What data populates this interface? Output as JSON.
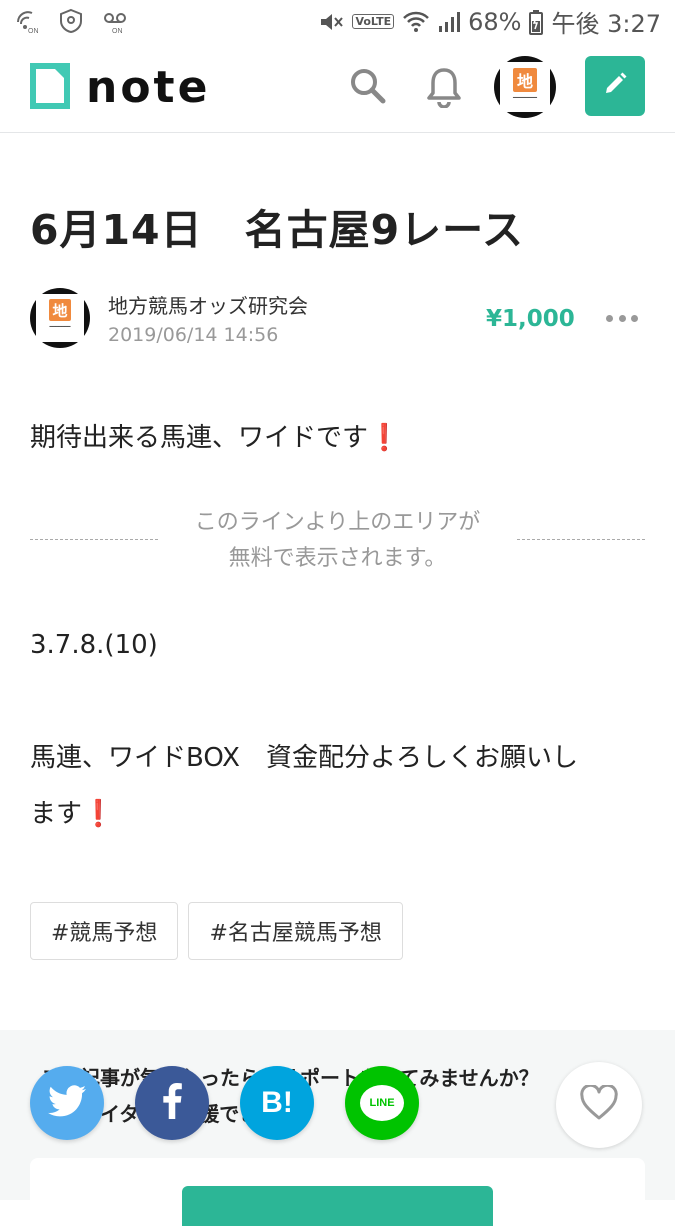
{
  "status_bar": {
    "battery": "68%",
    "time": "午後 3:27",
    "volte": "VoLTE",
    "left_icons": [
      "wifi-calling-icon",
      "shield-icon",
      "voicemail-icon"
    ],
    "right_icons": [
      "mute-icon",
      "wifi-icon",
      "signal-icon",
      "battery-charging-icon"
    ]
  },
  "header": {
    "logo_text": "note",
    "icons": [
      "search-icon",
      "bell-icon",
      "avatar",
      "edit-pencil-icon"
    ],
    "avatar_char": "地",
    "accent_color": "#2cb696"
  },
  "article": {
    "title": "6月14日　名古屋9レース",
    "author": {
      "name": "地方競馬オッズ研究会",
      "date": "2019/06/14 14:56",
      "avatar_char": "地"
    },
    "price": "¥1,000",
    "intro_text": "期待出来る馬連、ワイドです",
    "exclaim": "❗",
    "paywall_line1": "このラインより上のエリアが",
    "paywall_line2": "無料で表示されます。",
    "numbers": "3.7.8.(10)",
    "body_line1": "馬連、ワイドBOX　資金配分よろしくお願いし",
    "body_line2": "ます",
    "tags": [
      "#競馬予想",
      "#名古屋競馬予想"
    ]
  },
  "support": {
    "line1": "この記事が気に入ったら、サポートをしてみませんか？",
    "line2": "クリエイターを支援できます。"
  },
  "share": {
    "hatena_label": "B!",
    "line_label": "LINE",
    "colors": {
      "twitter": "#55acee",
      "facebook": "#3b5998",
      "hatena": "#00a4de",
      "line": "#00c300"
    }
  }
}
